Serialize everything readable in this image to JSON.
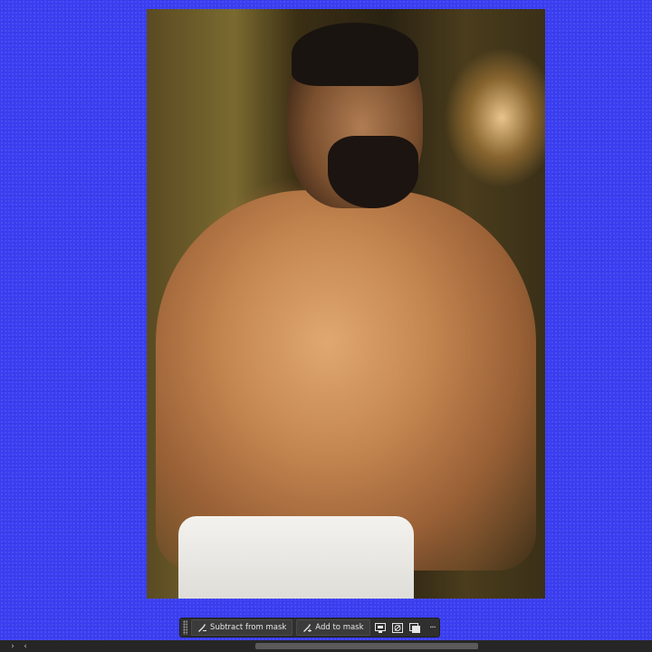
{
  "canvas": {
    "background_color": "#3a3ef0"
  },
  "context_bar": {
    "subtract_label": "Subtract from mask",
    "add_label": "Add to mask",
    "subtract_icon": "brush-minus-icon",
    "add_icon": "brush-plus-icon",
    "icons": [
      "mask-overlay-icon",
      "invert-mask-icon",
      "refine-mask-icon",
      "more-options-icon"
    ],
    "more_glyph": "···"
  },
  "scrollbar": {
    "left_arrow": "‹",
    "panel_toggle": "›"
  }
}
